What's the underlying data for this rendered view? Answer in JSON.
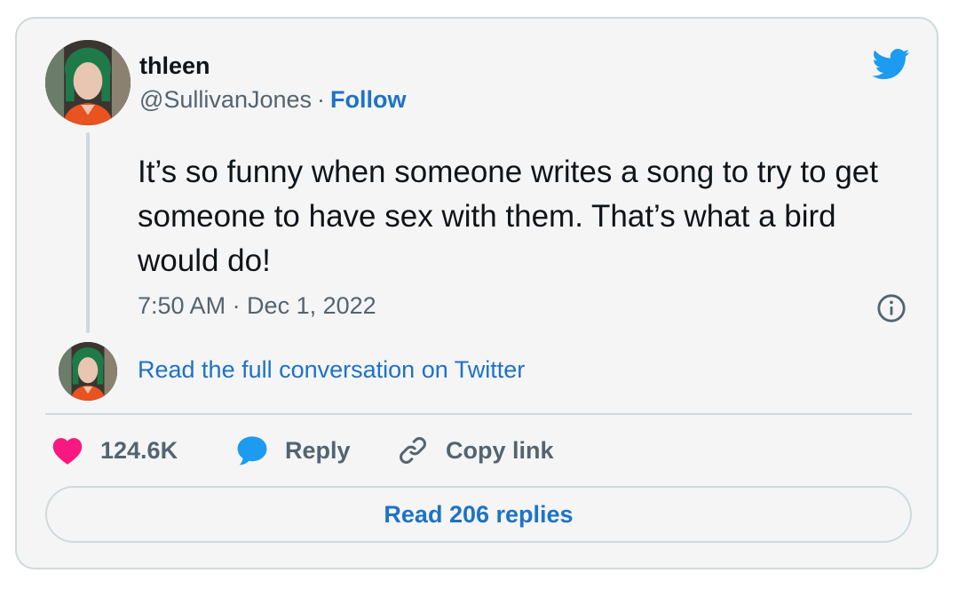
{
  "author": {
    "display_name": "thleen",
    "handle": "@SullivanJones",
    "separator": "·",
    "follow_label": "Follow"
  },
  "tweet": {
    "text": "It’s so funny when someone writes a song to try to get someone to have sex with them. That’s what a bird would do!",
    "timestamp": "7:50 AM · Dec 1, 2022"
  },
  "conversation": {
    "link_label": "Read the full conversation on Twitter"
  },
  "actions": {
    "like_count": "124.6K",
    "reply_label": "Reply",
    "copy_link_label": "Copy link"
  },
  "replies_button": {
    "label": "Read 206 replies"
  },
  "icons": {
    "brand": "twitter-bird-icon",
    "info": "info-icon",
    "like": "heart-icon",
    "reply": "speech-bubble-icon",
    "copy": "link-icon"
  },
  "colors": {
    "accent": "#1d9bf0",
    "link": "#1d72c9",
    "heart": "#f91880",
    "text": "#0f1419",
    "muted": "#536471",
    "border": "#cfd9de",
    "card_background": "#f5f5f5"
  }
}
